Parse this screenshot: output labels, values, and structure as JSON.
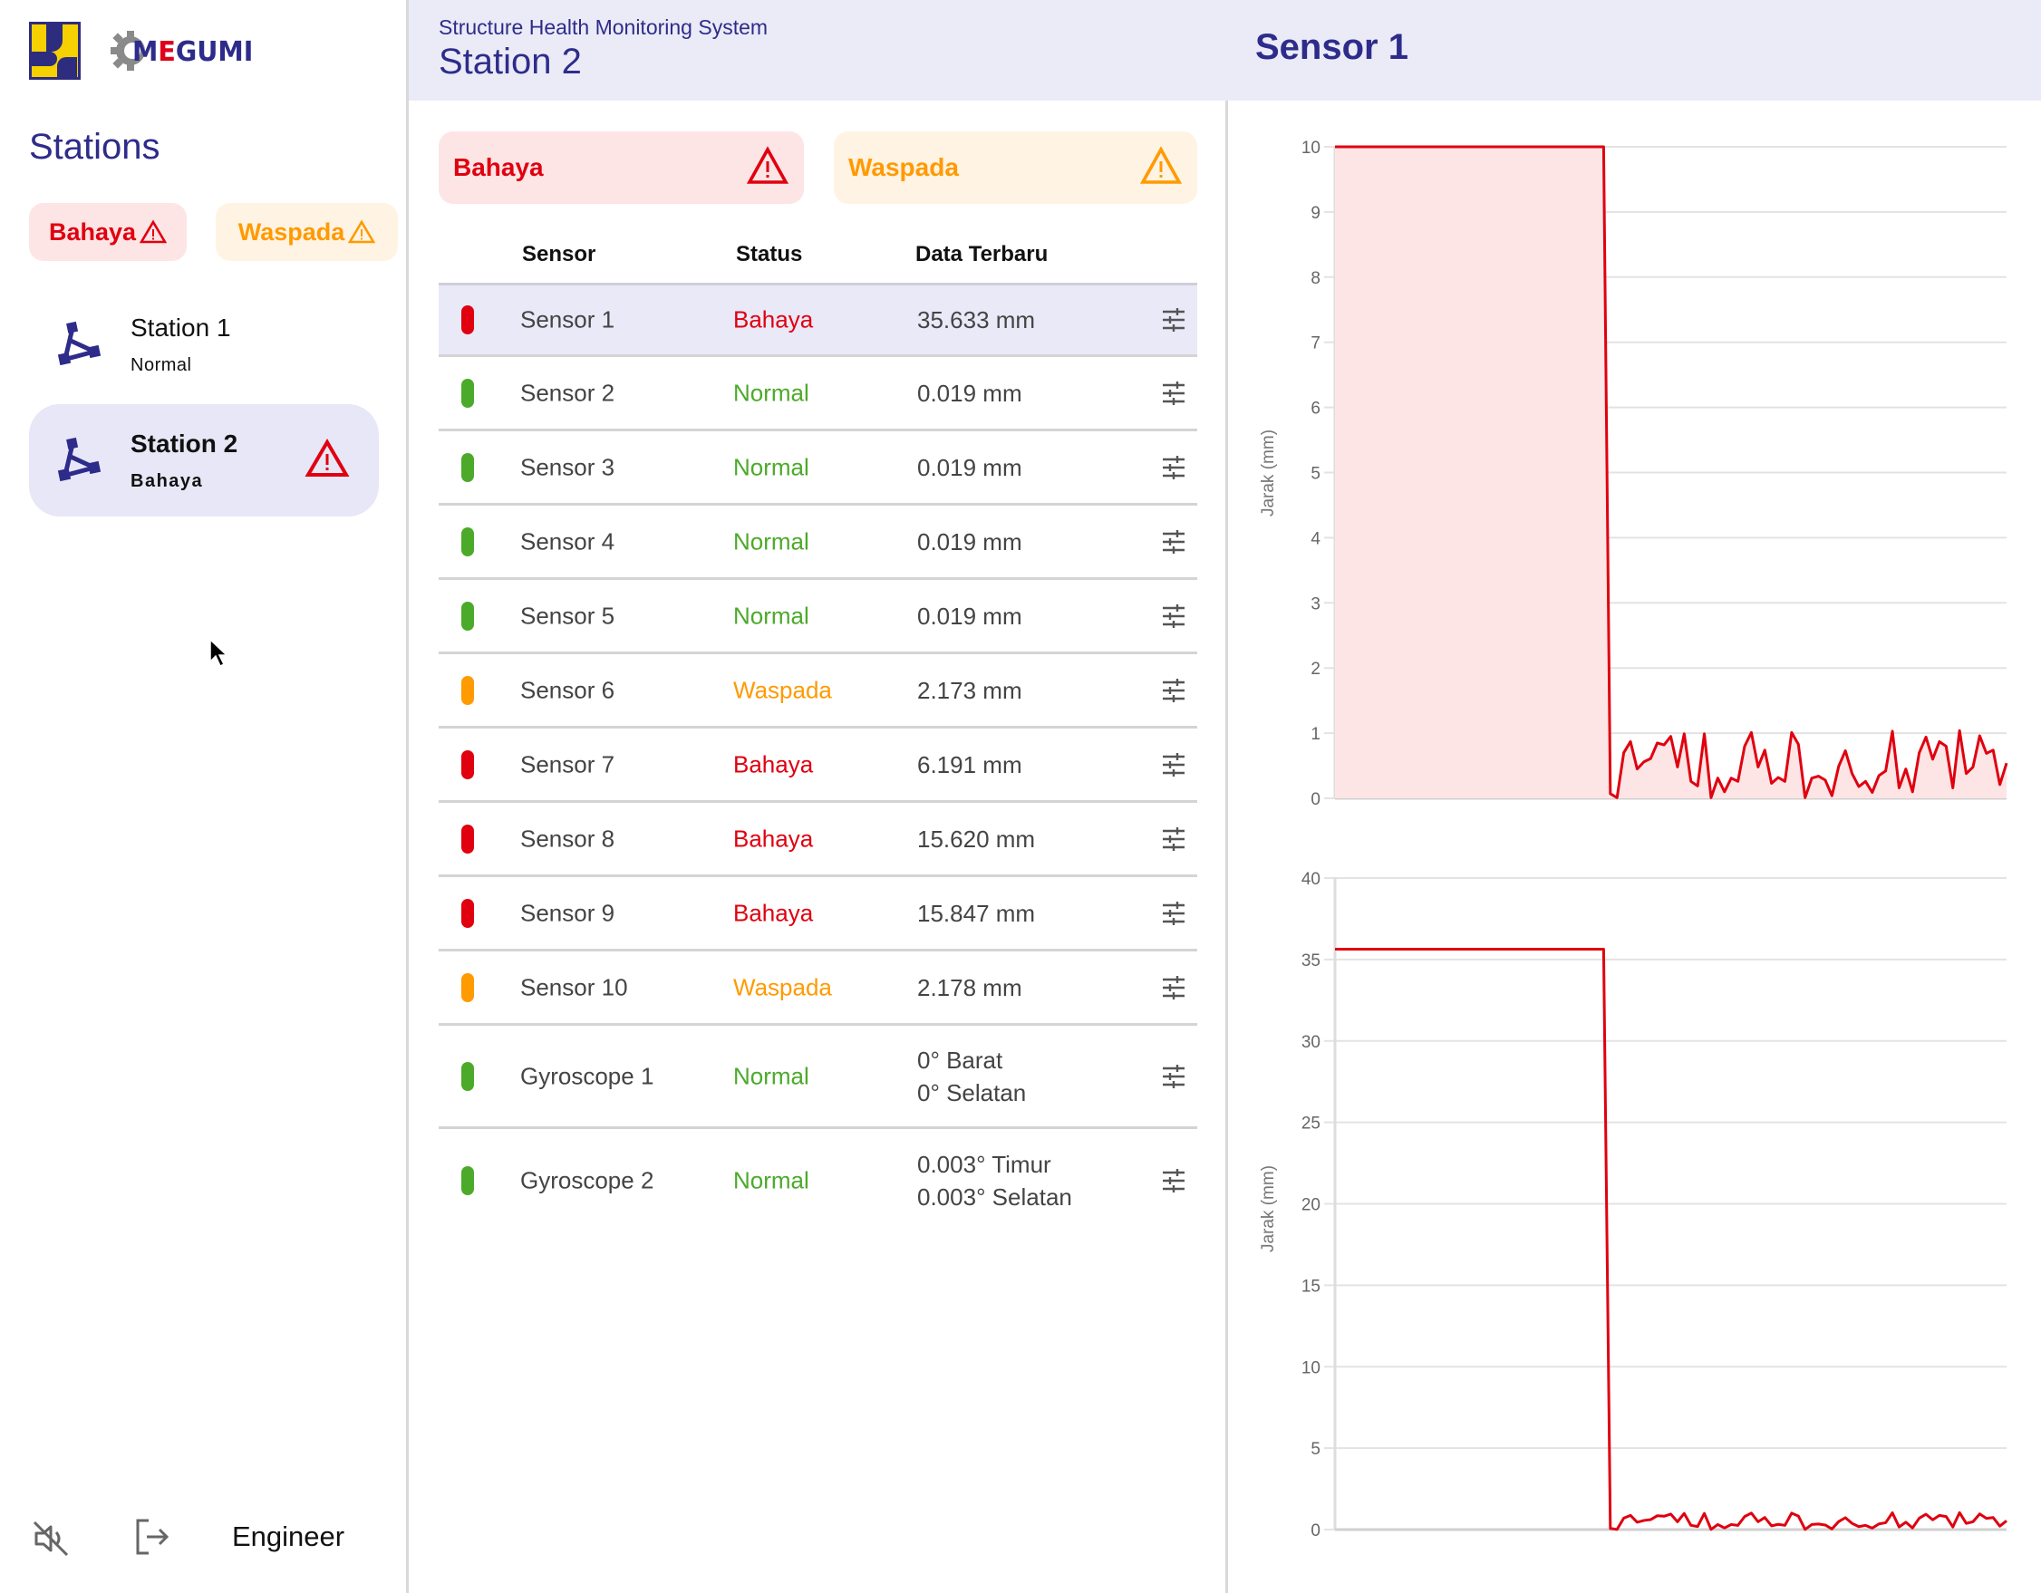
{
  "sidebar": {
    "brand": "MEGUMI",
    "brand_first": "M",
    "brand_accent": "E",
    "brand_rest": "GUMI",
    "section_title": "Stations",
    "chips": [
      {
        "label": "Bahaya",
        "icon": "warning-triangle-icon",
        "color": "#e0000f"
      },
      {
        "label": "Waspada",
        "icon": "warning-triangle-icon",
        "color": "#ff9a00"
      }
    ],
    "stations": [
      {
        "name": "Station 1",
        "status": "Normal",
        "icon": "station-network-icon",
        "alert": false
      },
      {
        "name": "Station 2",
        "status": "Bahaya",
        "icon": "station-network-icon",
        "alert": true,
        "selected": true
      }
    ],
    "footer": {
      "mute_icon": "volume-off-icon",
      "logout_icon": "logout-icon",
      "user_role": "Engineer"
    }
  },
  "header": {
    "subtitle": "Structure Health Monitoring System",
    "title": "Station 2",
    "selected_sensor": "Sensor 1"
  },
  "banners": [
    {
      "label": "Bahaya",
      "icon": "warning-triangle-icon",
      "color": "#e0000f"
    },
    {
      "label": "Waspada",
      "icon": "warning-triangle-icon",
      "color": "#ff9a00"
    }
  ],
  "table": {
    "columns": [
      "Sensor",
      "Status",
      "Data Terbaru"
    ],
    "rows": [
      {
        "sensor": "Sensor 1",
        "status": "Bahaya",
        "data": [
          "35.633 mm"
        ],
        "selected": true
      },
      {
        "sensor": "Sensor 2",
        "status": "Normal",
        "data": [
          "0.019 mm"
        ]
      },
      {
        "sensor": "Sensor 3",
        "status": "Normal",
        "data": [
          "0.019 mm"
        ]
      },
      {
        "sensor": "Sensor 4",
        "status": "Normal",
        "data": [
          "0.019 mm"
        ]
      },
      {
        "sensor": "Sensor 5",
        "status": "Normal",
        "data": [
          "0.019 mm"
        ]
      },
      {
        "sensor": "Sensor 6",
        "status": "Waspada",
        "data": [
          "2.173 mm"
        ]
      },
      {
        "sensor": "Sensor 7",
        "status": "Bahaya",
        "data": [
          "6.191 mm"
        ]
      },
      {
        "sensor": "Sensor 8",
        "status": "Bahaya",
        "data": [
          "15.620 mm"
        ]
      },
      {
        "sensor": "Sensor 9",
        "status": "Bahaya",
        "data": [
          "15.847 mm"
        ]
      },
      {
        "sensor": "Sensor 10",
        "status": "Waspada",
        "data": [
          "2.178 mm"
        ]
      },
      {
        "sensor": "Gyroscope 1",
        "status": "Normal",
        "data": [
          "0° Barat",
          "0° Selatan"
        ]
      },
      {
        "sensor": "Gyroscope 2",
        "status": "Normal",
        "data": [
          "0.003° Timur",
          "0.003° Selatan"
        ]
      }
    ],
    "row_action_icon": "tune-sliders-icon"
  },
  "status_colors": {
    "Bahaya": "#e0000f",
    "Waspada": "#ff9a00",
    "Normal": "#4caa2a"
  },
  "chart_data": [
    {
      "type": "area",
      "title": "",
      "xlabel": "",
      "ylabel": "Jarak (mm)",
      "ylim": [
        0,
        10
      ],
      "yticks": [
        0,
        1,
        2,
        3,
        4,
        5,
        6,
        7,
        8,
        9,
        10
      ],
      "grid": true,
      "series": [
        {
          "name": "Sensor 1",
          "color": "#e0000f",
          "fill": "#fde5e6",
          "x": [
            0,
            40,
            41,
            42,
            43,
            44,
            45,
            46,
            47,
            48,
            49,
            50,
            51,
            52,
            53,
            54,
            55,
            56,
            57,
            58,
            59,
            60,
            61,
            62,
            63,
            64,
            65,
            66,
            67,
            68,
            69,
            70,
            71,
            72,
            73,
            74,
            75,
            76,
            77,
            78,
            79,
            80,
            81,
            82,
            83,
            84,
            85,
            86,
            87,
            88,
            89,
            90,
            91,
            92,
            93,
            94,
            95,
            96,
            97,
            98,
            99,
            100
          ],
          "values": [
            35.633,
            35.633,
            0.07,
            0.01,
            0.7,
            0.87,
            0.45,
            0.56,
            0.61,
            0.85,
            0.82,
            0.95,
            0.48,
            0.99,
            0.26,
            0.19,
            0.99,
            0.01,
            0.31,
            0.1,
            0.31,
            0.26,
            0.8,
            1.01,
            0.48,
            0.74,
            0.23,
            0.32,
            0.26,
            1.01,
            0.83,
            0.01,
            0.31,
            0.34,
            0.28,
            0.04,
            0.49,
            0.73,
            0.38,
            0.18,
            0.26,
            0.09,
            0.35,
            0.42,
            1.03,
            0.16,
            0.45,
            0.1,
            0.7,
            0.94,
            0.6,
            0.87,
            0.8,
            0.16,
            1.04,
            0.38,
            0.48,
            0.96,
            0.69,
            0.74,
            0.21,
            0.54
          ]
        }
      ]
    },
    {
      "type": "line",
      "title": "",
      "xlabel": "",
      "ylabel": "Jarak (mm)",
      "ylim": [
        0,
        40
      ],
      "yticks": [
        0,
        5,
        10,
        15,
        20,
        25,
        30,
        35,
        40
      ],
      "grid": true,
      "series": [
        {
          "name": "Sensor 1",
          "color": "#e0000f",
          "x": [
            0,
            40,
            41,
            42,
            43,
            44,
            45,
            46,
            47,
            48,
            49,
            50,
            51,
            52,
            53,
            54,
            55,
            56,
            57,
            58,
            59,
            60,
            61,
            62,
            63,
            64,
            65,
            66,
            67,
            68,
            69,
            70,
            71,
            72,
            73,
            74,
            75,
            76,
            77,
            78,
            79,
            80,
            81,
            82,
            83,
            84,
            85,
            86,
            87,
            88,
            89,
            90,
            91,
            92,
            93,
            94,
            95,
            96,
            97,
            98,
            99,
            100
          ],
          "values": [
            35.633,
            35.633,
            0.07,
            0.01,
            0.7,
            0.87,
            0.45,
            0.56,
            0.61,
            0.85,
            0.82,
            0.95,
            0.48,
            0.99,
            0.26,
            0.19,
            0.99,
            0.01,
            0.31,
            0.1,
            0.31,
            0.26,
            0.8,
            1.01,
            0.48,
            0.74,
            0.23,
            0.32,
            0.26,
            1.01,
            0.83,
            0.01,
            0.31,
            0.34,
            0.28,
            0.04,
            0.49,
            0.73,
            0.38,
            0.18,
            0.26,
            0.09,
            0.35,
            0.42,
            1.03,
            0.16,
            0.45,
            0.1,
            0.7,
            0.94,
            0.6,
            0.87,
            0.8,
            0.16,
            1.04,
            0.38,
            0.48,
            0.96,
            0.69,
            0.74,
            0.21,
            0.54
          ]
        }
      ]
    }
  ]
}
